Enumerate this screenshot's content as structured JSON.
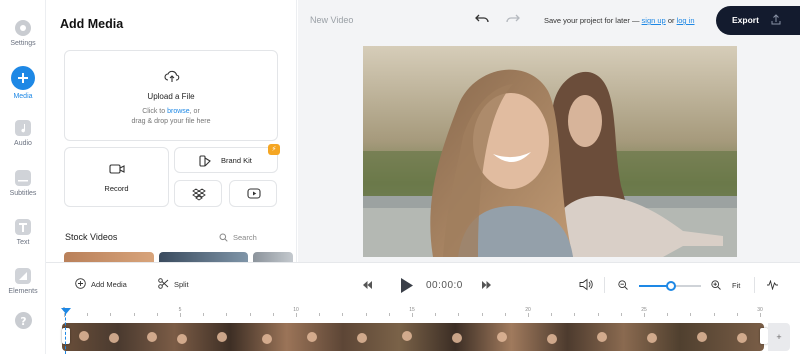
{
  "rail": [
    {
      "label": "Settings",
      "icon": "gear-icon"
    },
    {
      "label": "Media",
      "icon": "plus-icon",
      "active": true
    },
    {
      "label": "Audio",
      "icon": "music-icon"
    },
    {
      "label": "Subtitles",
      "icon": "subtitles-icon"
    },
    {
      "label": "Text",
      "icon": "text-icon"
    },
    {
      "label": "Elements",
      "icon": "elements-icon"
    },
    {
      "label": "",
      "icon": "help-icon"
    }
  ],
  "panel": {
    "title": "Add Media",
    "upload": {
      "title": "Upload a File",
      "line1_prefix": "Click to ",
      "line1_link": "browse",
      "line1_suffix": ", or",
      "line2": "drag & drop your file here"
    },
    "record_label": "Record",
    "brand_kit_label": "Brand Kit",
    "brand_kit_badge": "⚡",
    "stock_title": "Stock Videos",
    "search_placeholder": "Search"
  },
  "topbar": {
    "project_name": "New Video",
    "save_prefix": "Save your project for later — ",
    "signup": "sign up",
    "or": " or ",
    "login": "log in",
    "export_label": "Export"
  },
  "toolbar": {
    "add_media": "Add Media",
    "split": "Split",
    "time": "00:00:0",
    "fit": "Fit",
    "zoom_level": 0.52
  },
  "timeline": {
    "tick_labels": [
      "0",
      "5",
      "10",
      "15",
      "20",
      "25",
      "30"
    ]
  },
  "colors": {
    "accent": "#1e88e5",
    "export_bg": "#131b2e",
    "badge": "#f5a623"
  }
}
